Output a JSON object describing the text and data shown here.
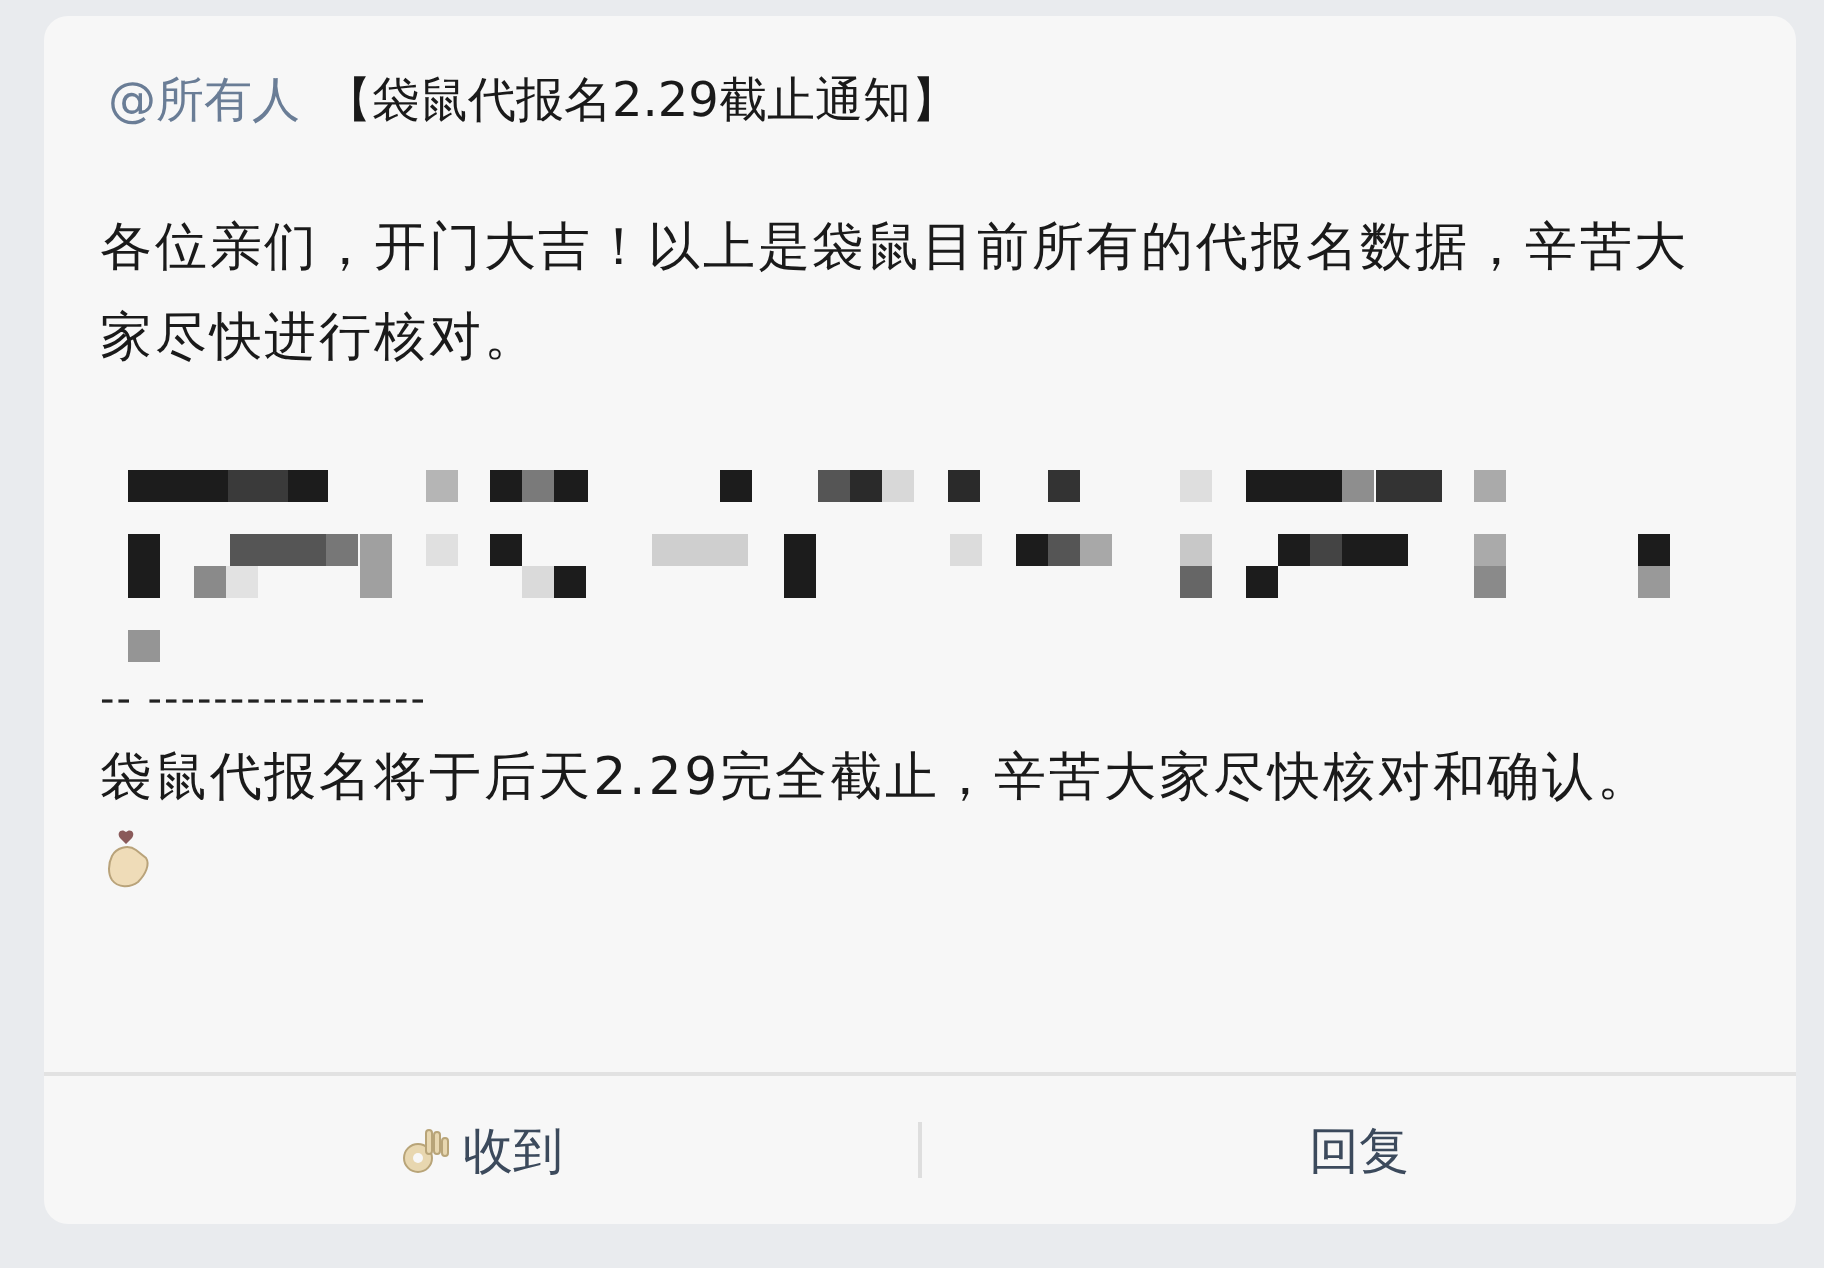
{
  "notice": {
    "mention": "@所有人",
    "title": "【袋鼠代报名2.29截止通知】",
    "greeting": "各位亲们，开门大吉！以上是袋鼠目前所有的代报名数据，辛苦大家尽快进行核对。",
    "separator": "-- -----------------",
    "closing": "袋鼠代报名将于后天2.29完全截止，辛苦大家尽快核对和确认。"
  },
  "actions": [
    {
      "label": "收到",
      "kind": "acknowledge"
    },
    {
      "label": "回复",
      "kind": "reply"
    }
  ]
}
